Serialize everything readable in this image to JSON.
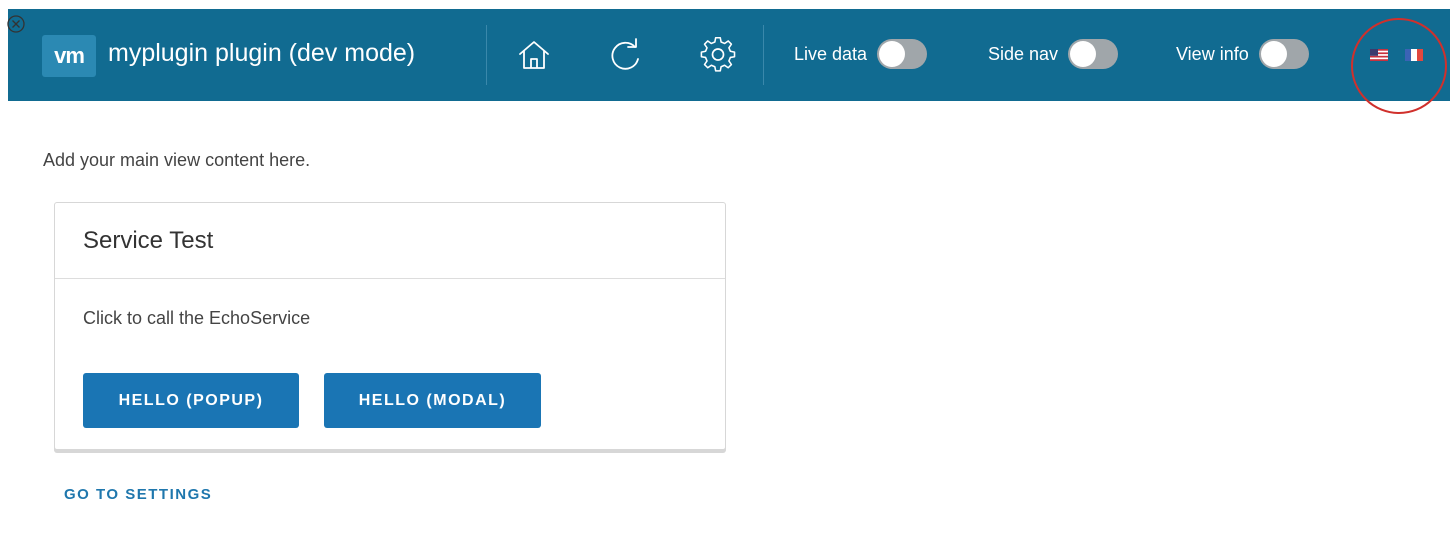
{
  "header": {
    "logo_text": "vm",
    "title": "myplugin plugin (dev mode)",
    "icons": [
      "home-icon",
      "refresh-icon",
      "gear-icon"
    ],
    "toggles": [
      {
        "label": "Live data",
        "state": "off"
      },
      {
        "label": "Side nav",
        "state": "off"
      },
      {
        "label": "View info",
        "state": "off"
      }
    ],
    "flags": [
      "us-flag-icon",
      "french-flag-icon"
    ],
    "background_color": "#116b91",
    "annotation_color": "#d0302c"
  },
  "main": {
    "intro_text": "Add your main view content here.",
    "card": {
      "title": "Service Test",
      "body_text": "Click to call the EchoService",
      "buttons": [
        {
          "label": "HELLO (POPUP)"
        },
        {
          "label": "HELLO (MODAL)"
        }
      ]
    },
    "settings_link": "GO TO SETTINGS"
  },
  "colors": {
    "primary_button": "#1a75b4",
    "link": "#1f77ad"
  }
}
